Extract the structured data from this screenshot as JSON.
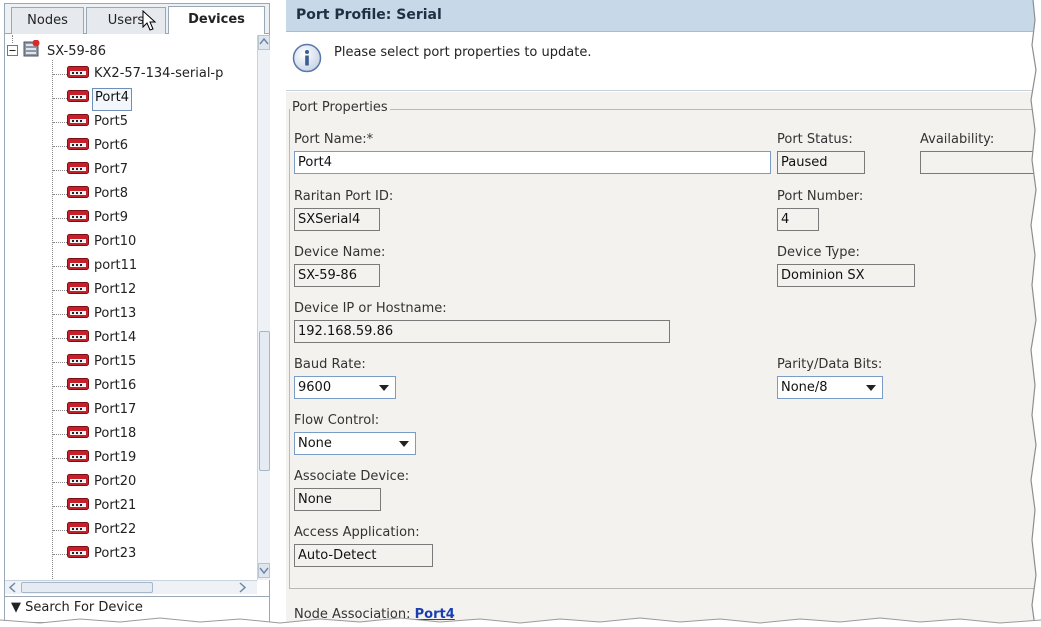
{
  "tabs": [
    {
      "label": "Nodes",
      "active": false
    },
    {
      "label": "Users",
      "active": false
    },
    {
      "label": "Devices",
      "active": true
    }
  ],
  "tree": {
    "device": "SX-59-86",
    "items": [
      "KX2-57-134-serial-p",
      "Port4",
      "Port5",
      "Port6",
      "Port7",
      "Port8",
      "Port9",
      "Port10",
      "port11",
      "Port12",
      "Port13",
      "Port14",
      "Port15",
      "Port16",
      "Port17",
      "Port18",
      "Port19",
      "Port20",
      "Port21",
      "Port22",
      "Port23"
    ],
    "selected_index": 1
  },
  "search_label": "▼ Search For Device",
  "header_title": "Port Profile: Serial",
  "info_message": "Please select port properties to update.",
  "form": {
    "legend": "Port Properties",
    "port_name_label": "Port Name:*",
    "port_name_value": "Port4",
    "port_status_label": "Port Status:",
    "port_status_value": "Paused",
    "availability_label": "Availability:",
    "availability_value": "",
    "raritan_id_label": "Raritan Port ID:",
    "raritan_id_value": "SXSerial4",
    "port_number_label": "Port Number:",
    "port_number_value": "4",
    "device_name_label": "Device Name:",
    "device_name_value": "SX-59-86",
    "device_type_label": "Device Type:",
    "device_type_value": "Dominion SX",
    "device_ip_label": "Device IP or Hostname:",
    "device_ip_value": "192.168.59.86",
    "baud_label": "Baud Rate:",
    "baud_value": "9600",
    "parity_label": "Parity/Data Bits:",
    "parity_value": "None/8",
    "flow_label": "Flow Control:",
    "flow_value": "None",
    "assoc_device_label": "Associate Device:",
    "assoc_device_value": "None",
    "access_app_label": "Access Application:",
    "access_app_value": "Auto-Detect"
  },
  "node_association_label": "Node Association:",
  "node_association_link": "Port4",
  "colors": {
    "header_bg": "#c7d8e9",
    "link": "#1a3fb0",
    "form_bg": "#f3f2ef"
  }
}
